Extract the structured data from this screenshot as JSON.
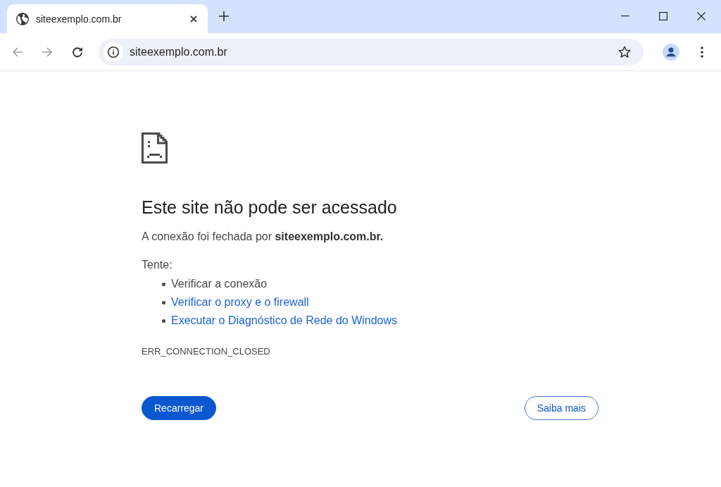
{
  "tabs": [
    {
      "title": "siteexemplo.com.br",
      "selected": true
    }
  ],
  "toolbar": {
    "navigation": [
      {
        "kind": "back",
        "disabled": true
      },
      {
        "kind": "forward",
        "disabled": true
      },
      {
        "kind": "reload",
        "disabled": false
      }
    ],
    "url": "siteexemplo.com.br",
    "bookmarked": false
  },
  "page": {
    "heading": "Este site não pode ser acessado",
    "message": "A conexão foi fechada por **siteexemplo.com.br.**",
    "try_label": "Tente:",
    "suggestions": [
      {
        "text": "Verificar a conexão",
        "kind": "text"
      },
      {
        "text": "Verificar o proxy e o firewall",
        "kind": "link"
      },
      {
        "text": "Executar o Diagnóstico de Rede do Windows",
        "kind": "link"
      }
    ],
    "error_code": "ERR_CONNECTION_CLOSED",
    "buttons": [
      {
        "label": "Recarregar",
        "kind": "primary"
      },
      {
        "label": "Saiba mais",
        "kind": "secondary"
      }
    ]
  }
}
